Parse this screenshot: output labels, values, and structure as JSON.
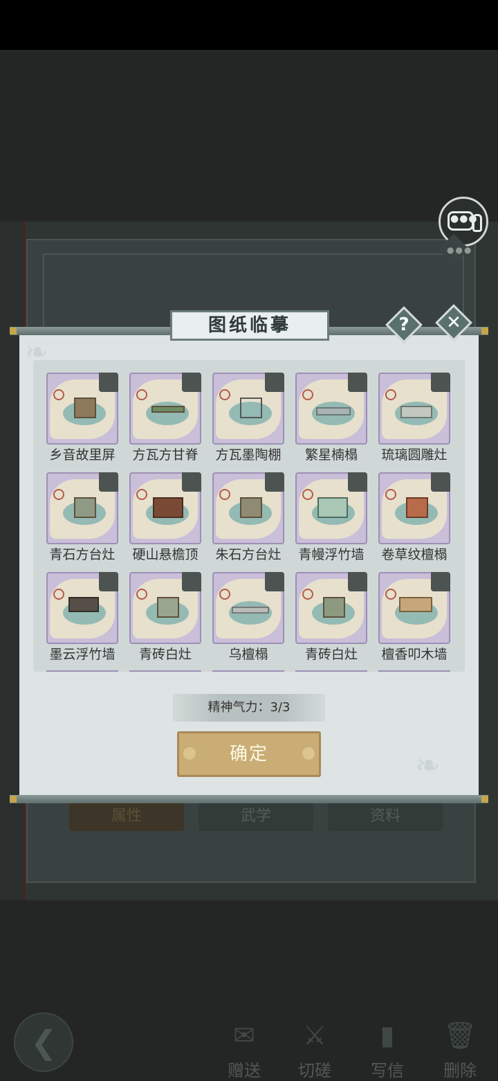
{
  "dialog": {
    "title": "图纸临摹",
    "help_label": "?",
    "close_label": "✕",
    "energy_text": "精神气力：3/3",
    "confirm_label": "确定"
  },
  "items": [
    {
      "name": "乡音故里屏"
    },
    {
      "name": "方瓦方甘脊"
    },
    {
      "name": "方瓦墨陶棚"
    },
    {
      "name": "繁星楠榻"
    },
    {
      "name": "琉璃圆雕灶"
    },
    {
      "name": "青石方台灶"
    },
    {
      "name": "硬山悬檐顶"
    },
    {
      "name": "朱石方台灶"
    },
    {
      "name": "青幔浮竹墙"
    },
    {
      "name": "卷草纹檀榻"
    },
    {
      "name": "墨云浮竹墙"
    },
    {
      "name": "青砖白灶"
    },
    {
      "name": "乌檀榻"
    },
    {
      "name": "青砖白灶"
    },
    {
      "name": "檀香叩木墙"
    }
  ],
  "background_tabs": [
    {
      "label": "属性"
    },
    {
      "label": "武学"
    },
    {
      "label": "资料"
    }
  ],
  "bottom_nav": [
    {
      "label": "赠送",
      "icon": "scroll-icon"
    },
    {
      "label": "切磋",
      "icon": "sword-icon"
    },
    {
      "label": "写信",
      "icon": "letter-icon"
    },
    {
      "label": "删除",
      "icon": "trash-icon"
    }
  ],
  "colors": {
    "dialog_bg": "#dde4e3",
    "card_bg": "#c9bfd9",
    "confirm_bg": "#c9ad74"
  }
}
